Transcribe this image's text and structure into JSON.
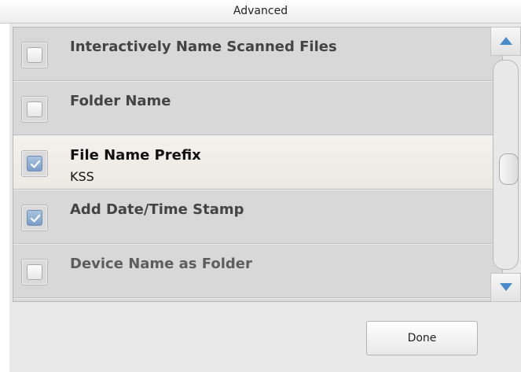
{
  "dialog": {
    "title": "Advanced"
  },
  "options": [
    {
      "label": "Interactively Name Scanned Files",
      "value": "",
      "checked": false,
      "selected": false
    },
    {
      "label": "Folder Name",
      "value": "",
      "checked": false,
      "selected": false
    },
    {
      "label": "File Name Prefix",
      "value": "KSS",
      "checked": true,
      "selected": true
    },
    {
      "label": "Add Date/Time Stamp",
      "value": "",
      "checked": true,
      "selected": false
    },
    {
      "label": "Device Name as Folder",
      "value": "",
      "checked": false,
      "selected": false
    }
  ],
  "scrollbar": {
    "up_icon": "triangle-up-icon",
    "down_icon": "triangle-down-icon"
  },
  "footer": {
    "done_label": "Done"
  },
  "colors": {
    "accent": "#4a8cc9",
    "checked_fill": "#7a9ec8",
    "selected_row": "#f2efea"
  }
}
